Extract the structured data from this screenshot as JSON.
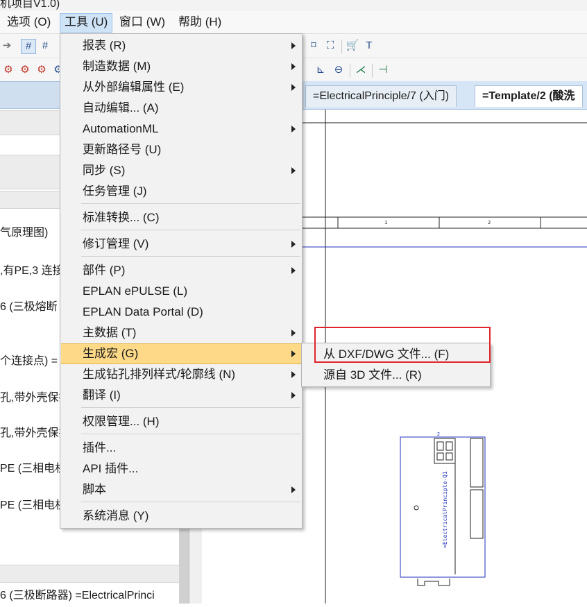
{
  "window": {
    "title_fragment": "机项目V1.0)"
  },
  "menubar": {
    "items": [
      {
        "label": "选项 (O)"
      },
      {
        "label": "工具 (U)"
      },
      {
        "label": "窗口 (W)"
      },
      {
        "label": "帮助 (H)"
      }
    ]
  },
  "tabs": [
    {
      "label": "=ElectricalPrinciple/7 (入门)"
    },
    {
      "label": "=Template/2 (酸洗"
    }
  ],
  "left_panel": {
    "rows": [
      "气原理图)",
      ",有PE,3 连接",
      "6 (三极熔断",
      "个连接点) =",
      "孔,带外壳保护",
      "孔,带外壳保护",
      "PE (三相电机",
      "PE (三相电机",
      "6 (三极断路器) =ElectricalPrinci"
    ]
  },
  "tools_menu": {
    "items": [
      {
        "label": "报表 (R)",
        "submenu": true
      },
      {
        "label": "制造数据 (M)",
        "submenu": true
      },
      {
        "label": "从外部编辑属性 (E)",
        "submenu": true
      },
      {
        "label": "自动编辑... (A)",
        "submenu": false
      },
      {
        "label": "AutomationML",
        "submenu": true
      },
      {
        "label": "更新路径号 (U)",
        "submenu": false
      },
      {
        "label": "同步 (S)",
        "submenu": true
      },
      {
        "label": "任务管理 (J)",
        "submenu": false
      },
      {
        "label": "标准转换... (C)",
        "submenu": false
      },
      {
        "label": "修订管理 (V)",
        "submenu": true
      },
      {
        "label": "部件 (P)",
        "submenu": true
      },
      {
        "label": "EPLAN ePULSE (L)",
        "submenu": false
      },
      {
        "label": "EPLAN Data Portal (D)",
        "submenu": false
      },
      {
        "label": "主数据 (T)",
        "submenu": true
      },
      {
        "label": "生成宏 (G)",
        "submenu": true,
        "highlighted": true
      },
      {
        "label": "生成钻孔排列样式/轮廓线 (N)",
        "submenu": true
      },
      {
        "label": "翻译 (I)",
        "submenu": true
      },
      {
        "label": "权限管理... (H)",
        "submenu": false
      },
      {
        "label": "插件...",
        "submenu": false
      },
      {
        "label": "API 插件...",
        "submenu": false
      },
      {
        "label": "脚本",
        "submenu": true
      },
      {
        "label": "系统消息 (Y)",
        "submenu": false
      }
    ]
  },
  "macro_submenu": {
    "items": [
      {
        "label": "从 DXF/DWG 文件... (F)"
      },
      {
        "label": "源自 3D 文件... (R)"
      }
    ]
  },
  "drawing": {
    "column_numbers": [
      "1",
      "2"
    ],
    "device_label": "=ElectricalPrinciple-Q1",
    "device_tag": "2"
  },
  "colors": {
    "menu_highlight": "#fdd988",
    "annotation_red": "#e0242b",
    "tab_bar": "#d6e6f6"
  }
}
